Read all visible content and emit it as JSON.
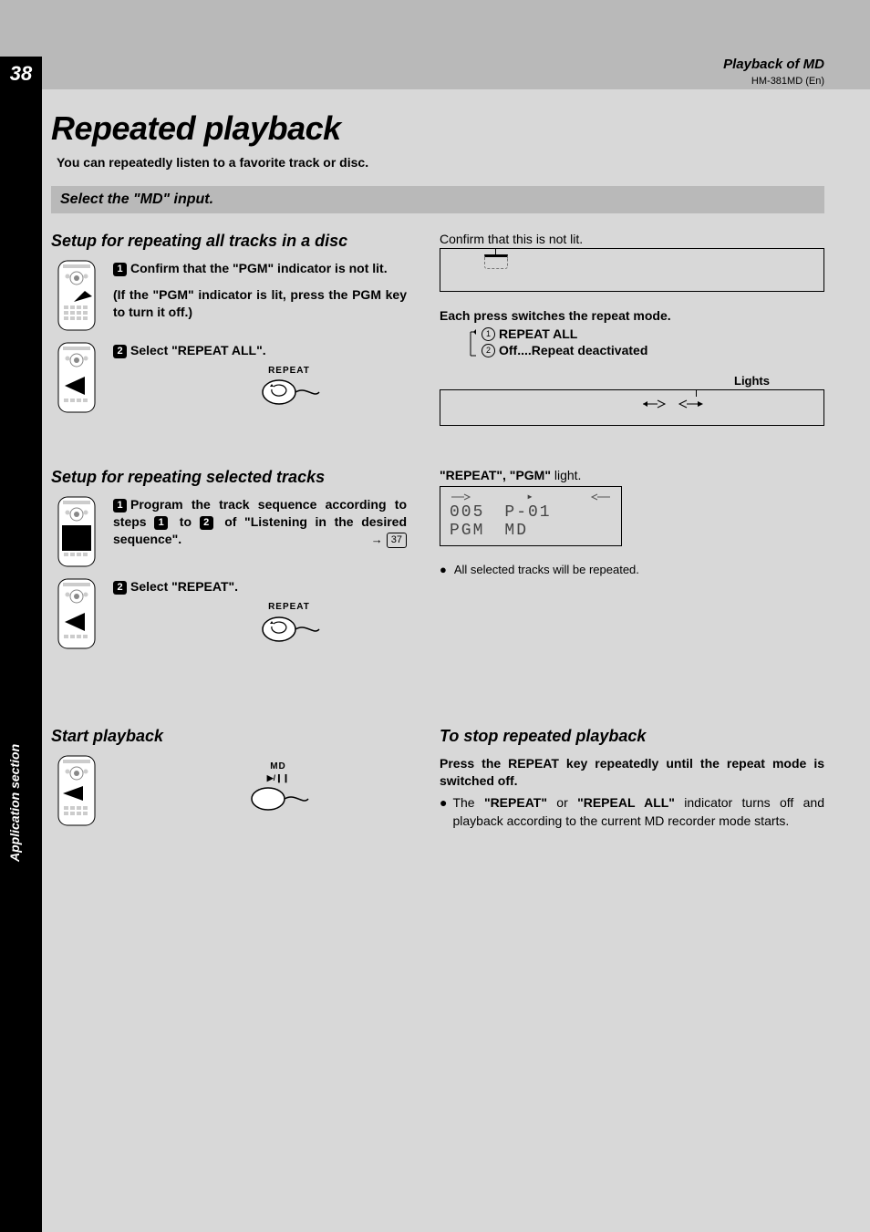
{
  "page_number": "38",
  "header": {
    "section": "Playback of MD",
    "model": "HM-381MD (En)"
  },
  "side_label": "Application section",
  "title": "Repeated playback",
  "intro": "You can repeatedly listen to a favorite track or disc.",
  "bar": "Select the \"MD\" input.",
  "setupAll": {
    "heading": "Setup for repeating all tracks in a disc",
    "step1_lead": "Confirm that the \"PGM\" indicator is not lit.",
    "step1_note": "(If the \"PGM\" indicator is lit, press the PGM key to turn it off.)",
    "step2_lead": "Select \"REPEAT ALL\".",
    "repeat_label": "REPEAT",
    "confirm_label": "Confirm that this is not lit.",
    "mode_lead": "Each press switches the repeat mode.",
    "mode1": "REPEAT ALL",
    "mode2": "Off....Repeat deactivated",
    "lights_label": "Lights"
  },
  "setupSel": {
    "heading": "Setup for repeating selected tracks",
    "step1_a": "Program the track sequence according to steps ",
    "step1_b": " to ",
    "step1_c": " of \"Listening in the desired sequence\".",
    "page_ref": "37",
    "step2_lead": "Select \"REPEAT\".",
    "repeat_label": "REPEAT",
    "rpt_pgm_label_a": "\"REPEAT\", \"PGM\"",
    "rpt_pgm_label_b": " light.",
    "lcd": {
      "track": "005",
      "prog": "P-01",
      "pgm": "PGM",
      "src": "MD"
    },
    "note": "All selected tracks will be repeated."
  },
  "start": {
    "heading": "Start playback",
    "md_label": "MD",
    "play_label": "▶/∎∎"
  },
  "stop": {
    "heading": "To stop repeated playback",
    "lead": "Press the REPEAT key repeatedly until the repeat mode is switched off.",
    "item_a": "The ",
    "item_b": "\"REPEAT\"",
    "item_c": " or ",
    "item_d": "\"REPEAL ALL\"",
    "item_e": " indicator turns off and playback according to the current MD recorder mode starts."
  },
  "badges": {
    "one": "1",
    "two": "2"
  }
}
